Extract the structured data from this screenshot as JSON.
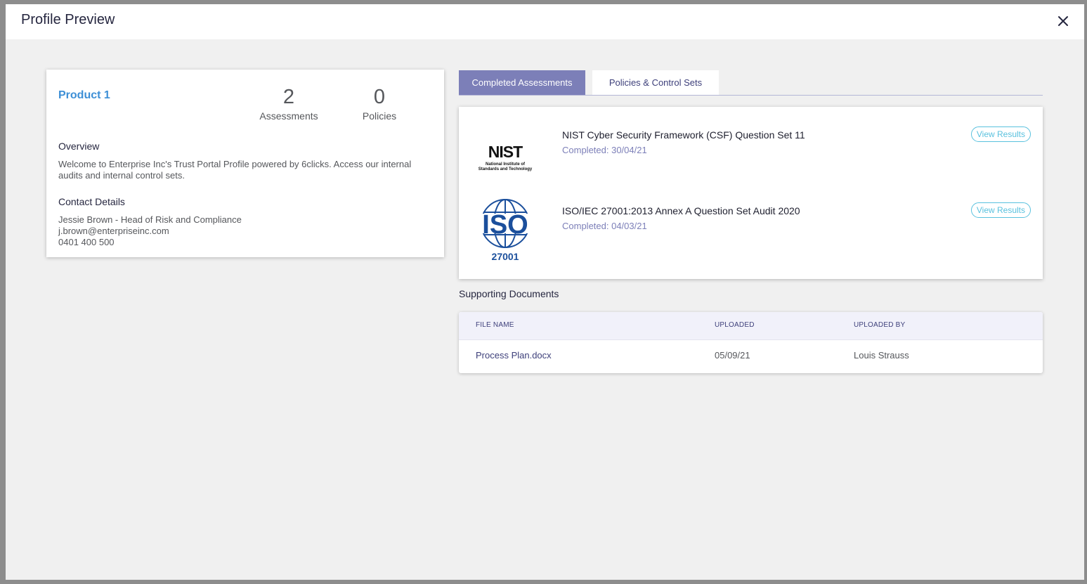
{
  "modal": {
    "title": "Profile Preview",
    "close_icon": "close-icon"
  },
  "profile": {
    "product_name": "Product 1",
    "stats": [
      {
        "value": "2",
        "label": "Assessments"
      },
      {
        "value": "0",
        "label": "Policies"
      }
    ],
    "overview_title": "Overview",
    "overview_text": "Welcome to Enterprise Inc's Trust Portal Profile powered by 6clicks. Access our internal audits and internal control sets.",
    "contact_title": "Contact Details",
    "contact_name": "Jessie Brown - Head of Risk and Compliance",
    "contact_email": "j.brown@enterpriseinc.com",
    "contact_phone": "0401 400 500"
  },
  "tabs": [
    {
      "label": "Completed Assessments",
      "active": true
    },
    {
      "label": "Policies & Control Sets",
      "active": false
    }
  ],
  "assessments": [
    {
      "logo": "nist-logo",
      "logo_text": {
        "main": "NIST",
        "sub1": "National Institute of",
        "sub2": "Standards and Technology"
      },
      "title": "NIST Cyber Security Framework (CSF) Question Set 11",
      "completed": "Completed: 30/04/21",
      "button": "View Results"
    },
    {
      "logo": "iso-27001-logo",
      "logo_text": {
        "main": "ISO",
        "sub1": "27001"
      },
      "title": "ISO/IEC 27001:2013 Annex A Question Set Audit 2020",
      "completed": "Completed: 04/03/21",
      "button": "View Results"
    }
  ],
  "documents": {
    "title": "Supporting Documents",
    "headers": [
      "FILE NAME",
      "UPLOADED",
      "UPLOADED BY"
    ],
    "rows": [
      {
        "file_name": "Process Plan.docx",
        "uploaded": "05/09/21",
        "uploaded_by": "Louis Strauss"
      }
    ]
  },
  "colors": {
    "accent": "#7c7fb8",
    "link": "#3d8fd6",
    "view_button": "#59c1de",
    "iso_blue": "#1b4f9c"
  }
}
